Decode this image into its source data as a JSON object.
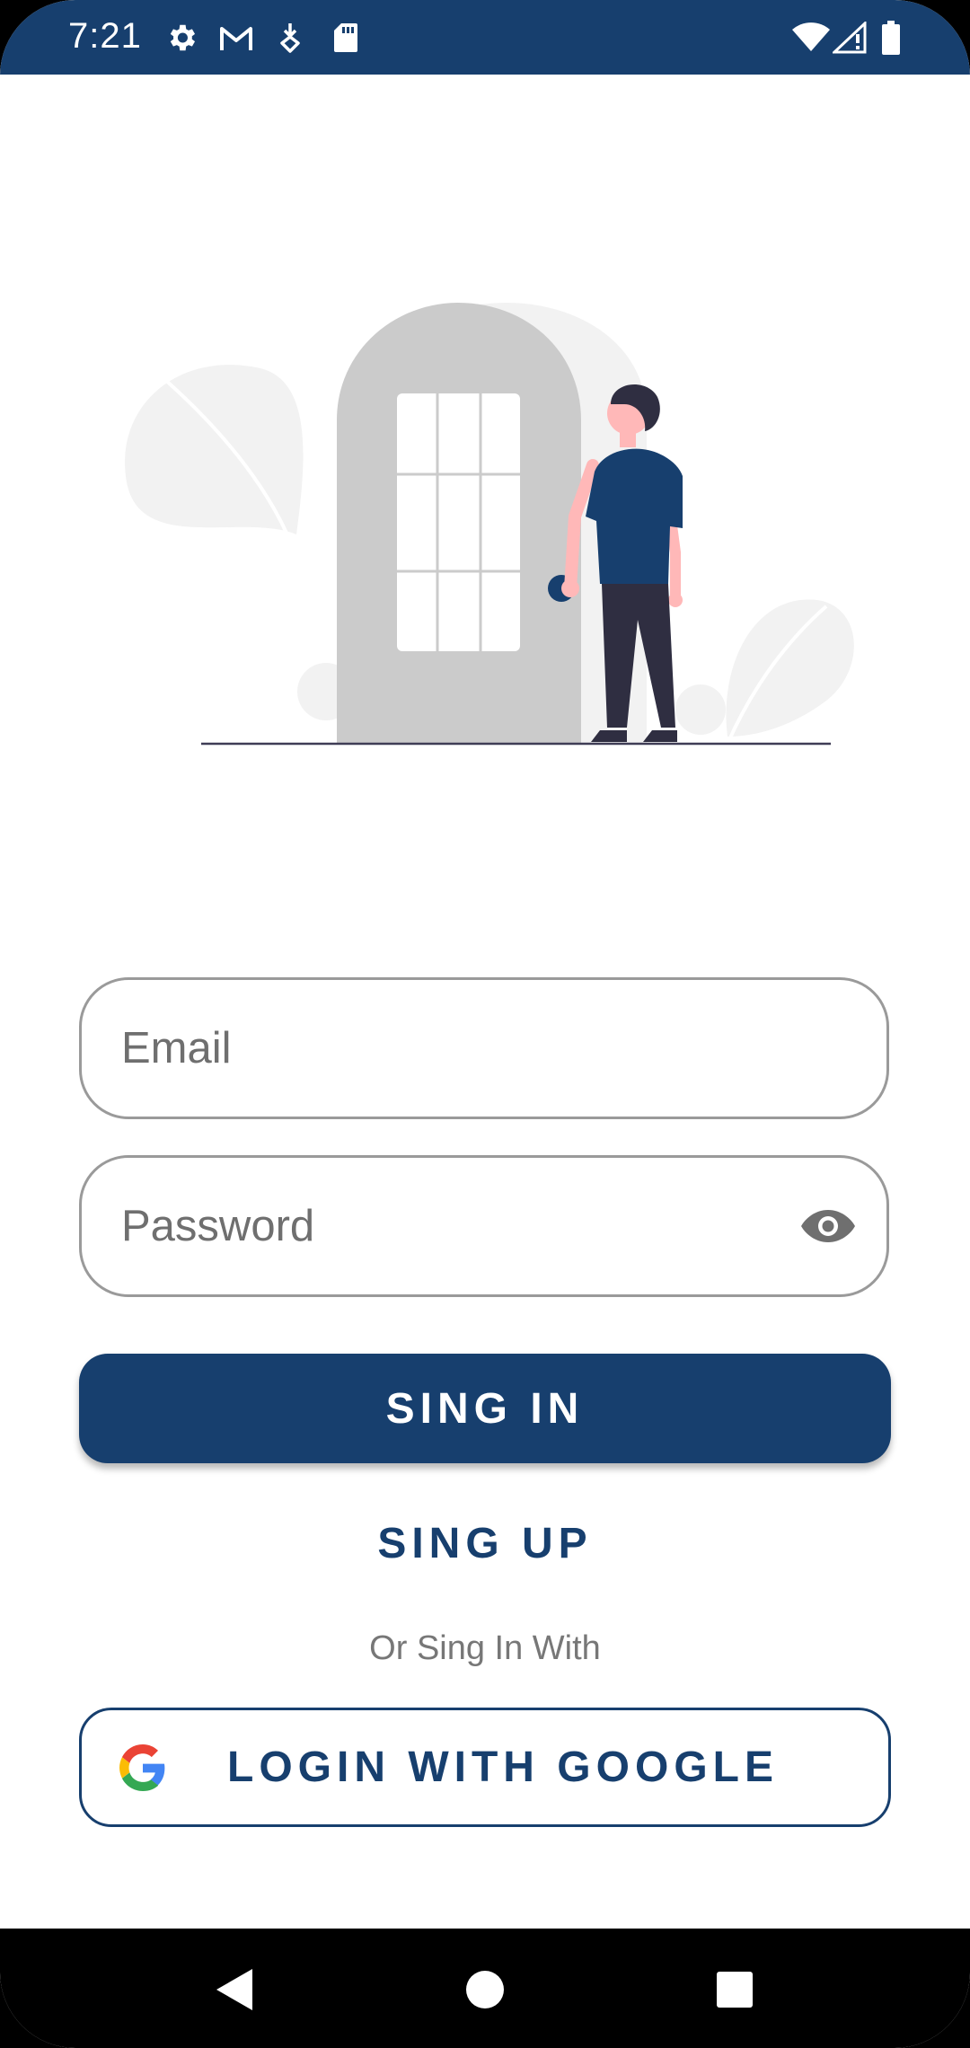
{
  "status_bar": {
    "time": "7:21",
    "icons_left": [
      "settings-icon",
      "gmail-icon",
      "download-icon",
      "sd-card-icon"
    ],
    "icons_right": [
      "wifi-icon",
      "signal-icon",
      "battery-icon"
    ],
    "background": "#173f6e"
  },
  "illustration": {
    "name": "person-at-door-illustration",
    "accent": "#173f6e"
  },
  "form": {
    "email": {
      "placeholder": "Email",
      "value": ""
    },
    "password": {
      "placeholder": "Password",
      "value": "",
      "toggle_icon": "eye-icon"
    }
  },
  "actions": {
    "sign_in_label": "SING IN",
    "sign_up_label": "SING UP",
    "divider_text": "Or Sing In With",
    "google_label": "LOGIN WITH GOOGLE",
    "google_icon": "google-logo-icon"
  },
  "nav_bar": {
    "buttons": [
      "back-icon",
      "home-icon",
      "recents-icon"
    ]
  },
  "colors": {
    "primary": "#173f6e",
    "placeholder": "#6f6f6f",
    "border": "#9a9a9a"
  }
}
